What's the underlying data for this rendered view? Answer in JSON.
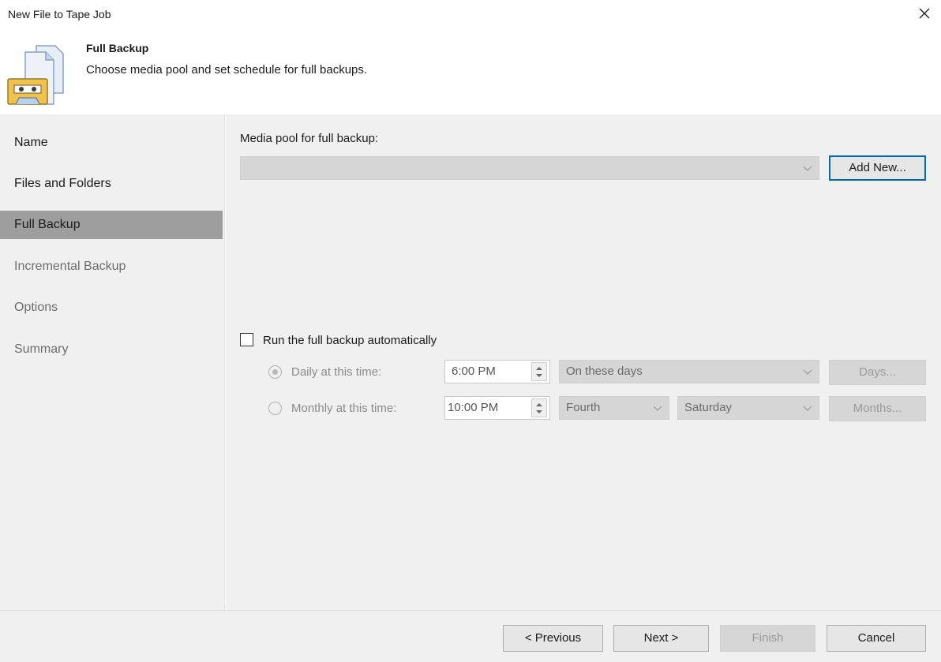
{
  "window": {
    "title": "New File to Tape Job"
  },
  "header": {
    "title": "Full Backup",
    "subtitle": "Choose media pool and set schedule for full backups."
  },
  "sidebar": {
    "items": [
      {
        "label": "Name",
        "state": "done"
      },
      {
        "label": "Files and Folders",
        "state": "done"
      },
      {
        "label": "Full Backup",
        "state": "active"
      },
      {
        "label": "Incremental Backup",
        "state": "pending"
      },
      {
        "label": "Options",
        "state": "pending"
      },
      {
        "label": "Summary",
        "state": "pending"
      }
    ]
  },
  "media_pool": {
    "label": "Media pool for full backup:",
    "value": "",
    "add_new_label": "Add New..."
  },
  "schedule": {
    "auto_label": "Run the full backup automatically",
    "auto_checked": false,
    "daily": {
      "label": "Daily at this time:",
      "selected": true,
      "time": "6:00 PM",
      "days_option": "On these days",
      "days_button": "Days..."
    },
    "monthly": {
      "label": "Monthly at this time:",
      "selected": false,
      "time": "10:00 PM",
      "week_option": "Fourth",
      "day_option": "Saturday",
      "months_button": "Months..."
    }
  },
  "footer": {
    "previous_label": "< Previous",
    "next_label": "Next >",
    "finish_label": "Finish",
    "cancel_label": "Cancel"
  },
  "colors": {
    "accent": "#0067c0",
    "panel": "#f0f0f0",
    "active_nav": "#9e9e9e",
    "disabled_field": "#d6d6d6"
  }
}
